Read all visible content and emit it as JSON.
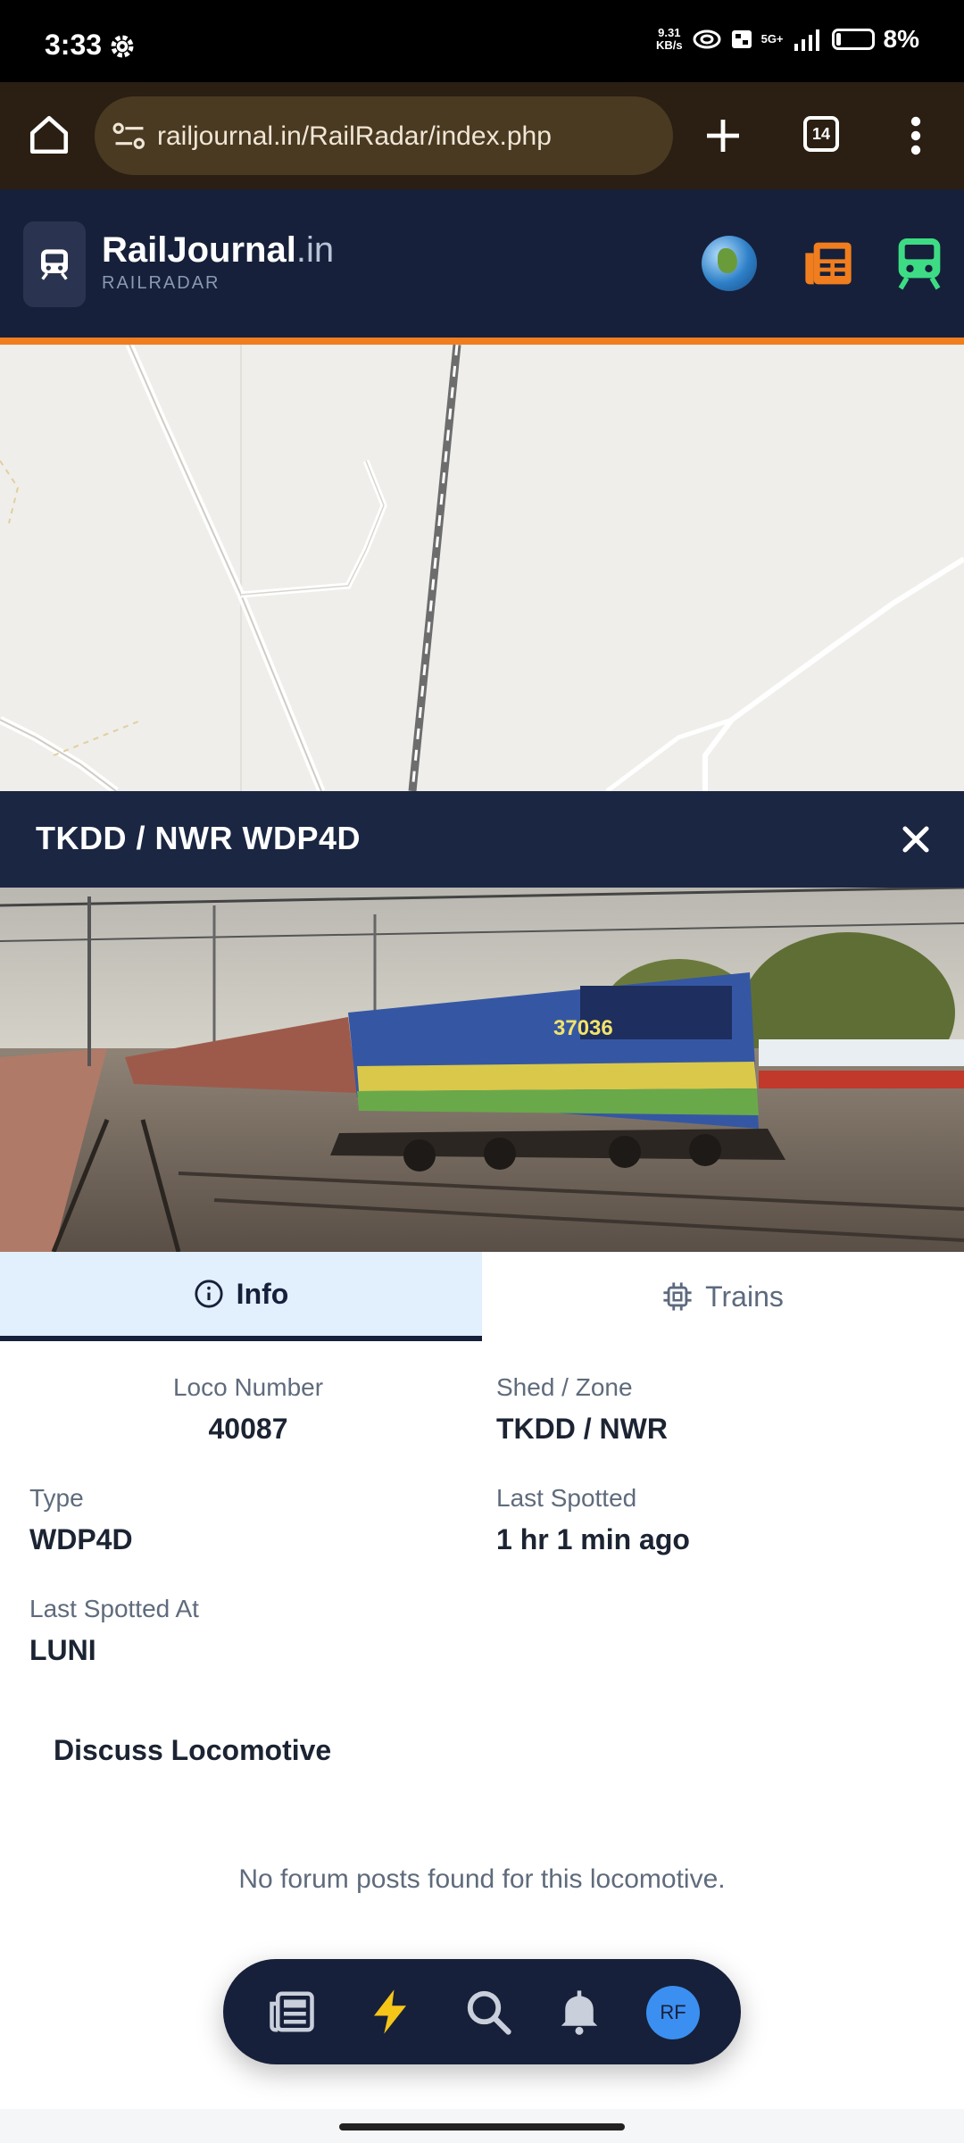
{
  "status_bar": {
    "time": "3:33",
    "net_speed_top": "9.31",
    "net_speed_bottom": "KB/s",
    "network": "5G+",
    "battery": "8%"
  },
  "browser": {
    "url": "railjournal.in/RailRadar/index.php",
    "tab_count": "14"
  },
  "site": {
    "brand_main": "RailJournal",
    "brand_tld": ".in",
    "brand_sub": "RAILRADAR"
  },
  "panel": {
    "title": "TKDD / NWR WDP4D"
  },
  "tabs": {
    "info": "Info",
    "trains": "Trains"
  },
  "info": {
    "loco_number_label": "Loco Number",
    "loco_number": "40087",
    "shed_zone_label": "Shed / Zone",
    "shed_zone": "TKDD / NWR",
    "type_label": "Type",
    "type": "WDP4D",
    "last_spotted_label": "Last Spotted",
    "last_spotted": "1 hr 1 min ago",
    "last_spotted_at_label": "Last Spotted At",
    "last_spotted_at": "LUNI"
  },
  "discussion": {
    "heading": "Discuss Locomotive",
    "empty": "No forum posts found for this locomotive."
  },
  "bottom_nav": {
    "avatar_initials": "RF"
  },
  "colors": {
    "header_bg": "#16203a",
    "accent_orange": "#f07d1e",
    "accent_green": "#3ddc84",
    "avatar_blue": "#3b8ff0"
  }
}
